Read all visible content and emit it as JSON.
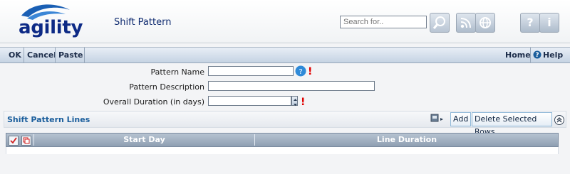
{
  "header": {
    "logo_text": "agility",
    "page_title": "Shift Pattern",
    "search_placeholder": "Search for..",
    "icons": [
      "search-icon",
      "rss-icon",
      "globe-icon",
      "help-icon",
      "info-icon"
    ],
    "help_label": "?",
    "info_label": "i"
  },
  "menubar": {
    "items": [
      "OK",
      "Cancel",
      "Paste"
    ],
    "home_label": "Home",
    "help_label": "Help"
  },
  "form": {
    "pattern_name_label": "Pattern Name",
    "pattern_description_label": "Pattern Description",
    "overall_duration_label": "Overall Duration (in days)",
    "required_marker": "!"
  },
  "section": {
    "title": "Shift Pattern Lines",
    "add_label": "Add",
    "delete_selected_label": "Delete Selected Rows"
  },
  "table": {
    "columns": [
      "Start Day",
      "Line Duration"
    ]
  },
  "colors": {
    "brand": "#0d2a86",
    "accent": "#1b5e9c",
    "required": "#e00000"
  }
}
